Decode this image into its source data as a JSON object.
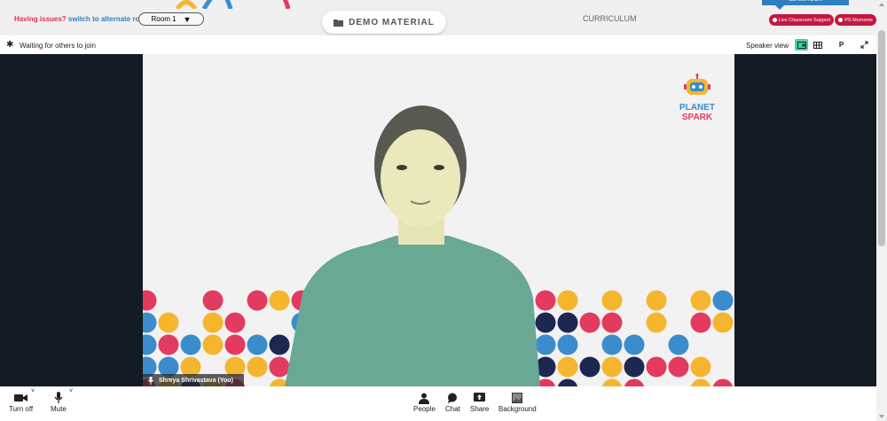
{
  "topbar": {
    "issues_question": "Having issues?",
    "issues_link": "switch to alternate room",
    "room_selected": "Room 1",
    "demo_material": "DEMO MATERIAL",
    "curriculum": "CURRICULUM",
    "classroom_tab": "CLASSROOM",
    "live_support": "Live Classroom Support",
    "ps_moments": "PS Moments"
  },
  "panel": {
    "waiting": "Waiting for others to join",
    "speaker_view": "Speaker view",
    "p_button": "P"
  },
  "video": {
    "logo_line1": "PLANET",
    "logo_line2": "SPARK",
    "participant_name": "Shreya Shrivastava (You)"
  },
  "controls": {
    "camera": "Turn off",
    "mic": "Mute",
    "people": "People",
    "chat": "Chat",
    "share": "Share",
    "background": "Background"
  },
  "colors": {
    "accent_red": "#c41741",
    "link_blue": "#2d7fc1",
    "active_view": "#3dd6a0",
    "stage_bg": "#131b24",
    "dot_blue": "#3a8ccc",
    "dot_yellow": "#f6b52e",
    "dot_red": "#e33a5f",
    "dot_navy": "#1e2752"
  }
}
